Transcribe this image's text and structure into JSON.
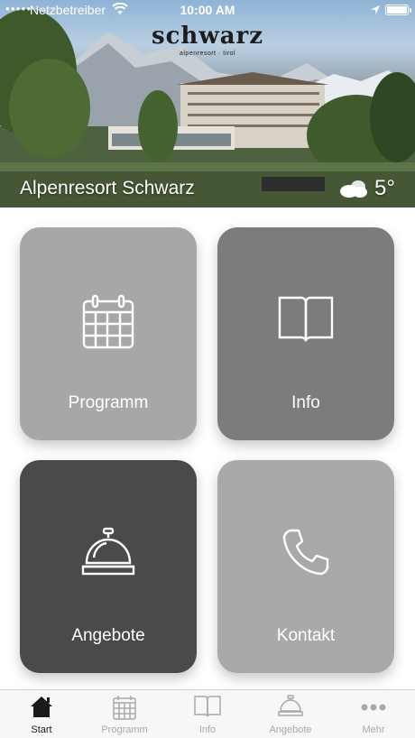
{
  "status_bar": {
    "carrier": "Netzbetreiber",
    "time": "10:00 AM"
  },
  "header": {
    "logo_text": "schwarz",
    "logo_tagline": "alpenresort · tirol",
    "resort_name": "Alpenresort Schwarz",
    "weather": {
      "icon": "cloudy-icon",
      "temperature": "5°"
    }
  },
  "tiles": [
    {
      "label": "Programm",
      "icon": "calendar-icon",
      "color": "#a7a7a7"
    },
    {
      "label": "Info",
      "icon": "book-icon",
      "color": "#7c7c7c"
    },
    {
      "label": "Angebote",
      "icon": "service-bell-icon",
      "color": "#4a4a4a"
    },
    {
      "label": "Kontakt",
      "icon": "phone-icon",
      "color": "#a9a9a9"
    }
  ],
  "tab_bar": {
    "items": [
      {
        "label": "Start",
        "icon": "home-icon",
        "active": true
      },
      {
        "label": "Programm",
        "icon": "calendar-icon",
        "active": false
      },
      {
        "label": "Info",
        "icon": "book-icon",
        "active": false
      },
      {
        "label": "Angebote",
        "icon": "service-bell-icon",
        "active": false
      },
      {
        "label": "Mehr",
        "icon": "more-dots-icon",
        "active": false
      }
    ]
  }
}
